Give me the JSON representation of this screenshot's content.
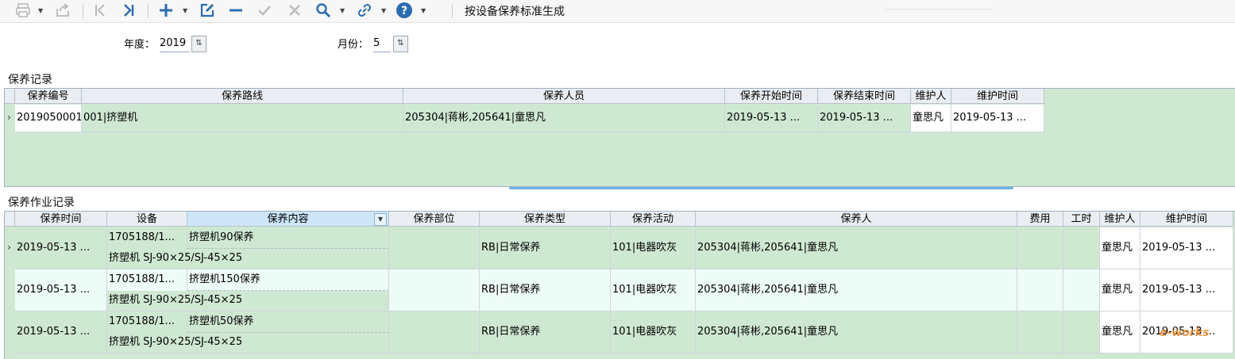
{
  "toolbar": {
    "title_text": "按设备保养标准生成",
    "icons": [
      "print-icon",
      "export-icon",
      "first-page-icon",
      "last-page-icon",
      "add-icon",
      "edit-icon",
      "remove-icon",
      "check-icon",
      "close-icon",
      "search-icon",
      "link-icon",
      "help-icon"
    ]
  },
  "filters": {
    "year_label": "年度：",
    "year_value": "2019",
    "month_label": "月份：",
    "month_value": "5"
  },
  "records": {
    "section_title": "保养记录",
    "columns": [
      "保养编号",
      "保养路线",
      "保养人员",
      "保养开始时间",
      "保养结束时间",
      "维护人",
      "维护时间"
    ],
    "rows": [
      [
        "2019050001",
        "001|挤塑机",
        "205304|蒋彬,205641|童思凡",
        "2019-05-13 ...",
        "2019-05-13 ...",
        "童思凡",
        "2019-05-13 ..."
      ]
    ]
  },
  "tasks": {
    "section_title": "保养作业记录",
    "columns": [
      "保养时间",
      "设备",
      "保养内容",
      "保养部位",
      "保养类型",
      "保养活动",
      "保养人",
      "费用",
      "工时",
      "维护人",
      "维护时间"
    ],
    "rows": [
      {
        "time": "2019-05-13 ...",
        "device_code": "1705188/1...",
        "content": "挤塑机90保养",
        "device_name": "挤塑机 SJ-90×25/SJ-45×25",
        "part": "",
        "type": "RB|日常保养",
        "activity": "101|电器吹灰",
        "person": "205304|蒋彬,205641|童思凡",
        "cost": "",
        "hours": "",
        "maintainer": "童思凡",
        "mtime": "2019-05-13 ..."
      },
      {
        "time": "2019-05-13 ...",
        "device_code": "1705188/1...",
        "content": "挤塑机150保养",
        "device_name": "挤塑机 SJ-90×25/SJ-45×25",
        "part": "",
        "type": "RB|日常保养",
        "activity": "101|电器吹灰",
        "person": "205304|蒋彬,205641|童思凡",
        "cost": "",
        "hours": "",
        "maintainer": "童思凡",
        "mtime": "2019-05-13 ..."
      },
      {
        "time": "2019-05-13 ...",
        "device_code": "1705188/1...",
        "content": "挤塑机50保养",
        "device_name": "挤塑机 SJ-90×25/SJ-45×25",
        "part": "",
        "type": "RB|日常保养",
        "activity": "101|电器吹灰",
        "person": "205304|蒋彬,205641|童思凡",
        "cost": "",
        "hours": "",
        "maintainer": "童思凡",
        "mtime": "2019-05-13 ..."
      }
    ]
  },
  "watermark": "e-works",
  "colors": {
    "accent": "#2b6cb0",
    "grid_bg": "#cfe8d2",
    "alt_row": "#eefcf7"
  }
}
